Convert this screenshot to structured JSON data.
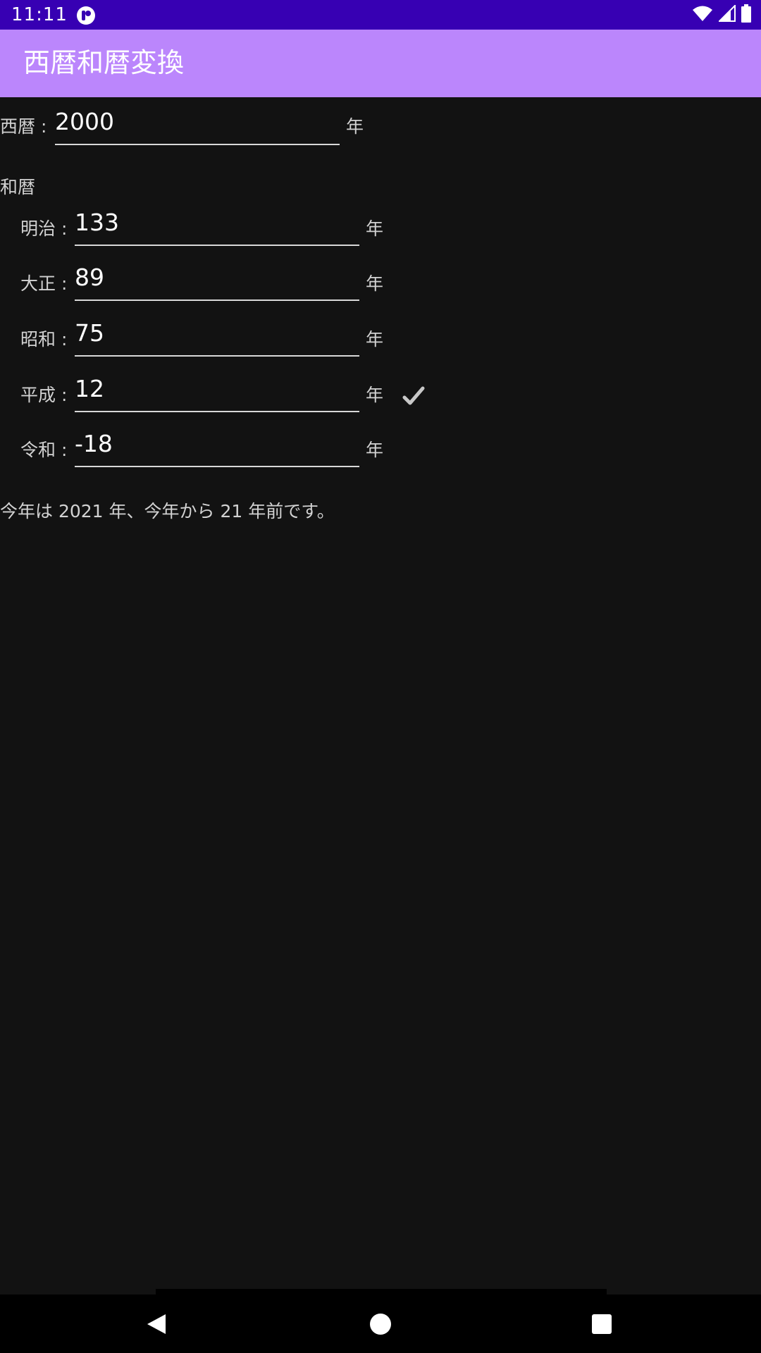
{
  "status_bar": {
    "time": "11:11"
  },
  "app_bar": {
    "title": "西暦和暦変換"
  },
  "seireki": {
    "label": "西暦 :",
    "value": "2000",
    "unit": "年"
  },
  "wareki": {
    "heading": "和暦",
    "eras": [
      {
        "label": "明治 :",
        "value": "133",
        "unit": "年"
      },
      {
        "label": "大正 :",
        "value": "89",
        "unit": "年"
      },
      {
        "label": "昭和 :",
        "value": "75",
        "unit": "年"
      },
      {
        "label": "平成 :",
        "value": "12",
        "unit": "年"
      },
      {
        "label": "令和 :",
        "value": "-18",
        "unit": "年"
      }
    ]
  },
  "summary": "今年は 2021 年、今年から 21 年前です。",
  "icons": {
    "status_app": "app-notification-icon",
    "wifi": "wifi-icon",
    "signal": "cell-signal-icon",
    "battery": "battery-icon",
    "check": "checkmark-icon",
    "nav_back": "back-triangle-icon",
    "nav_home": "home-circle-icon",
    "nav_recents": "recents-square-icon"
  },
  "colors": {
    "status_bar": "#3700b3",
    "app_bar": "#bb86fc",
    "background": "#121212"
  }
}
